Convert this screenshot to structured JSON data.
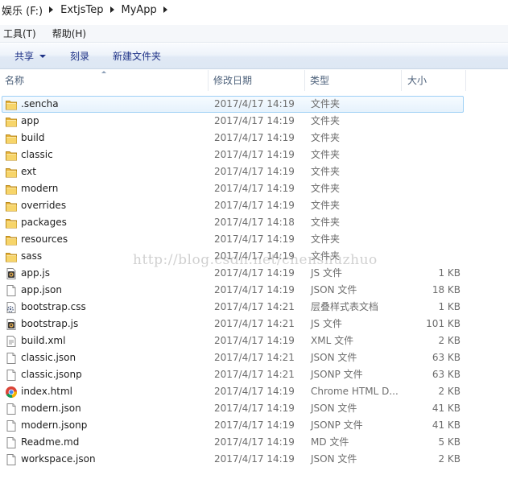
{
  "breadcrumb": [
    "娱乐 (F:)",
    "ExtjsTep",
    "MyApp"
  ],
  "menu": [
    {
      "label": "工具(T)"
    },
    {
      "label": "帮助(H)"
    }
  ],
  "commands": {
    "share": "共享",
    "burn": "刻录",
    "new_folder": "新建文件夹"
  },
  "columns": {
    "name": "名称",
    "date": "修改日期",
    "type": "类型",
    "size": "大小"
  },
  "files": [
    {
      "name": ".sencha",
      "date": "2017/4/17 14:19",
      "type": "文件夹",
      "size": "",
      "icon": "folder-icon",
      "selected": true
    },
    {
      "name": "app",
      "date": "2017/4/17 14:19",
      "type": "文件夹",
      "size": "",
      "icon": "folder-icon"
    },
    {
      "name": "build",
      "date": "2017/4/17 14:19",
      "type": "文件夹",
      "size": "",
      "icon": "folder-icon"
    },
    {
      "name": "classic",
      "date": "2017/4/17 14:19",
      "type": "文件夹",
      "size": "",
      "icon": "folder-icon"
    },
    {
      "name": "ext",
      "date": "2017/4/17 14:19",
      "type": "文件夹",
      "size": "",
      "icon": "folder-icon"
    },
    {
      "name": "modern",
      "date": "2017/4/17 14:19",
      "type": "文件夹",
      "size": "",
      "icon": "folder-icon"
    },
    {
      "name": "overrides",
      "date": "2017/4/17 14:19",
      "type": "文件夹",
      "size": "",
      "icon": "folder-icon"
    },
    {
      "name": "packages",
      "date": "2017/4/17 14:18",
      "type": "文件夹",
      "size": "",
      "icon": "folder-icon"
    },
    {
      "name": "resources",
      "date": "2017/4/17 14:19",
      "type": "文件夹",
      "size": "",
      "icon": "folder-icon"
    },
    {
      "name": "sass",
      "date": "2017/4/17 14:19",
      "type": "文件夹",
      "size": "",
      "icon": "folder-icon"
    },
    {
      "name": "app.js",
      "date": "2017/4/17 14:19",
      "type": "JS 文件",
      "size": "1 KB",
      "icon": "js-file-icon"
    },
    {
      "name": "app.json",
      "date": "2017/4/17 14:19",
      "type": "JSON 文件",
      "size": "18 KB",
      "icon": "generic-file-icon"
    },
    {
      "name": "bootstrap.css",
      "date": "2017/4/17 14:21",
      "type": "层叠样式表文档",
      "size": "1 KB",
      "icon": "css-file-icon"
    },
    {
      "name": "bootstrap.js",
      "date": "2017/4/17 14:21",
      "type": "JS 文件",
      "size": "101 KB",
      "icon": "js-file-icon"
    },
    {
      "name": "build.xml",
      "date": "2017/4/17 14:19",
      "type": "XML 文件",
      "size": "2 KB",
      "icon": "xml-file-icon"
    },
    {
      "name": "classic.json",
      "date": "2017/4/17 14:21",
      "type": "JSON 文件",
      "size": "63 KB",
      "icon": "generic-file-icon"
    },
    {
      "name": "classic.jsonp",
      "date": "2017/4/17 14:21",
      "type": "JSONP 文件",
      "size": "63 KB",
      "icon": "generic-file-icon"
    },
    {
      "name": "index.html",
      "date": "2017/4/17 14:19",
      "type": "Chrome HTML D...",
      "size": "2 KB",
      "icon": "chrome-icon"
    },
    {
      "name": "modern.json",
      "date": "2017/4/17 14:19",
      "type": "JSON 文件",
      "size": "41 KB",
      "icon": "generic-file-icon"
    },
    {
      "name": "modern.jsonp",
      "date": "2017/4/17 14:19",
      "type": "JSONP 文件",
      "size": "41 KB",
      "icon": "generic-file-icon"
    },
    {
      "name": "Readme.md",
      "date": "2017/4/17 14:19",
      "type": "MD 文件",
      "size": "5 KB",
      "icon": "generic-file-icon"
    },
    {
      "name": "workspace.json",
      "date": "2017/4/17 14:19",
      "type": "JSON 文件",
      "size": "2 KB",
      "icon": "generic-file-icon"
    }
  ],
  "watermark": "http://blog.csdn.net/chenshuzhuo"
}
